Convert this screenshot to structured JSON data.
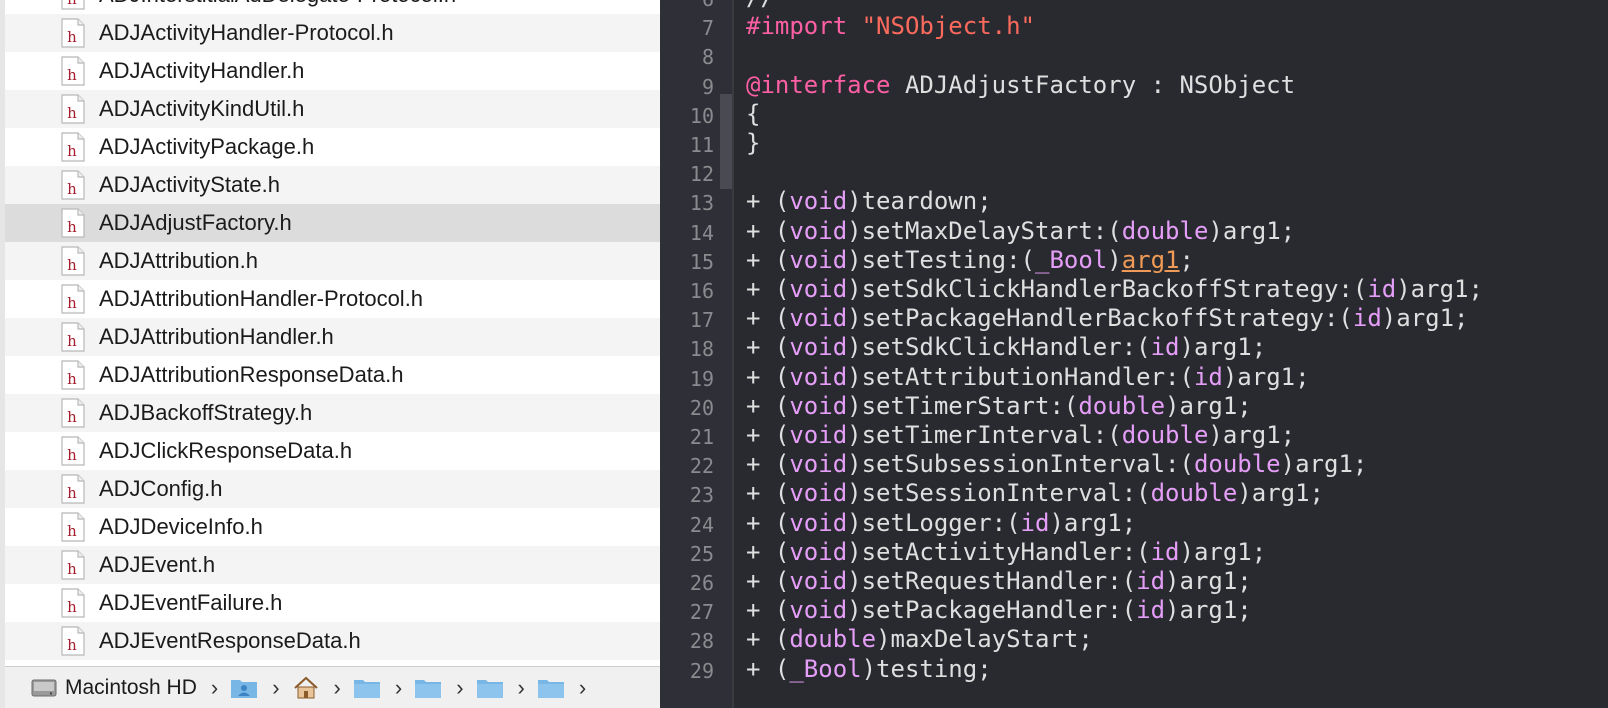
{
  "files": [
    {
      "name": "ADJInterstitialAdDelegate-Protocol.h"
    },
    {
      "name": "ADJActivityHandler-Protocol.h"
    },
    {
      "name": "ADJActivityHandler.h"
    },
    {
      "name": "ADJActivityKindUtil.h"
    },
    {
      "name": "ADJActivityPackage.h"
    },
    {
      "name": "ADJActivityState.h"
    },
    {
      "name": "ADJAdjustFactory.h",
      "selected": true
    },
    {
      "name": "ADJAttribution.h"
    },
    {
      "name": "ADJAttributionHandler-Protocol.h"
    },
    {
      "name": "ADJAttributionHandler.h"
    },
    {
      "name": "ADJAttributionResponseData.h"
    },
    {
      "name": "ADJBackoffStrategy.h"
    },
    {
      "name": "ADJClickResponseData.h"
    },
    {
      "name": "ADJConfig.h"
    },
    {
      "name": "ADJDeviceInfo.h"
    },
    {
      "name": "ADJEvent.h"
    },
    {
      "name": "ADJEventFailure.h"
    },
    {
      "name": "ADJEventResponseData.h"
    }
  ],
  "file_icon_letter": "h",
  "path_bar": {
    "root": "Macintosh HD",
    "separator": "›",
    "folders": [
      "user-folder-icon",
      "home-icon",
      "folder-icon",
      "folder-icon",
      "folder-icon",
      "folder-icon"
    ]
  },
  "colors": {
    "keyword": "#fc5fa3",
    "type": "#e59ef7",
    "string": "#fc6a5d",
    "text": "#dfdfe0",
    "editor_bg": "#292a30"
  },
  "code": [
    {
      "n": "6",
      "tokens": [
        {
          "t": "//",
          "c": "cls"
        }
      ]
    },
    {
      "n": "7",
      "tokens": [
        {
          "t": "#import ",
          "c": "kw"
        },
        {
          "t": "\"NSObject.h\"",
          "c": "str"
        }
      ]
    },
    {
      "n": "8",
      "tokens": []
    },
    {
      "n": "9",
      "tokens": [
        {
          "t": "@interface",
          "c": "kw"
        },
        {
          "t": " ADJAdjustFactory : NSObject",
          "c": "cls"
        }
      ]
    },
    {
      "n": "10",
      "tokens": [
        {
          "t": "{",
          "c": "cls"
        }
      ]
    },
    {
      "n": "11",
      "tokens": [
        {
          "t": "}",
          "c": "cls"
        }
      ]
    },
    {
      "n": "12",
      "tokens": []
    },
    {
      "n": "13",
      "tokens": [
        {
          "t": "+ (",
          "c": "cls"
        },
        {
          "t": "void",
          "c": "ty"
        },
        {
          "t": ")teardown;",
          "c": "cls"
        }
      ]
    },
    {
      "n": "14",
      "tokens": [
        {
          "t": "+ (",
          "c": "cls"
        },
        {
          "t": "void",
          "c": "ty"
        },
        {
          "t": ")setMaxDelayStart:(",
          "c": "cls"
        },
        {
          "t": "double",
          "c": "ty"
        },
        {
          "t": ")arg1;",
          "c": "cls"
        }
      ]
    },
    {
      "n": "15",
      "tokens": [
        {
          "t": "+ (",
          "c": "cls"
        },
        {
          "t": "void",
          "c": "ty"
        },
        {
          "t": ")setTesting:(",
          "c": "cls"
        },
        {
          "t": "_Bool",
          "c": "ty"
        },
        {
          "t": ")",
          "c": "cls"
        },
        {
          "t": "arg1",
          "c": "warn"
        },
        {
          "t": ";",
          "c": "cls"
        }
      ]
    },
    {
      "n": "16",
      "tokens": [
        {
          "t": "+ (",
          "c": "cls"
        },
        {
          "t": "void",
          "c": "ty"
        },
        {
          "t": ")setSdkClickHandlerBackoffStrategy:(",
          "c": "cls"
        },
        {
          "t": "id",
          "c": "ty"
        },
        {
          "t": ")arg1;",
          "c": "cls"
        }
      ]
    },
    {
      "n": "17",
      "tokens": [
        {
          "t": "+ (",
          "c": "cls"
        },
        {
          "t": "void",
          "c": "ty"
        },
        {
          "t": ")setPackageHandlerBackoffStrategy:(",
          "c": "cls"
        },
        {
          "t": "id",
          "c": "ty"
        },
        {
          "t": ")arg1;",
          "c": "cls"
        }
      ]
    },
    {
      "n": "18",
      "tokens": [
        {
          "t": "+ (",
          "c": "cls"
        },
        {
          "t": "void",
          "c": "ty"
        },
        {
          "t": ")setSdkClickHandler:(",
          "c": "cls"
        },
        {
          "t": "id",
          "c": "ty"
        },
        {
          "t": ")arg1;",
          "c": "cls"
        }
      ]
    },
    {
      "n": "19",
      "tokens": [
        {
          "t": "+ (",
          "c": "cls"
        },
        {
          "t": "void",
          "c": "ty"
        },
        {
          "t": ")setAttributionHandler:(",
          "c": "cls"
        },
        {
          "t": "id",
          "c": "ty"
        },
        {
          "t": ")arg1;",
          "c": "cls"
        }
      ]
    },
    {
      "n": "20",
      "tokens": [
        {
          "t": "+ (",
          "c": "cls"
        },
        {
          "t": "void",
          "c": "ty"
        },
        {
          "t": ")setTimerStart:(",
          "c": "cls"
        },
        {
          "t": "double",
          "c": "ty"
        },
        {
          "t": ")arg1;",
          "c": "cls"
        }
      ]
    },
    {
      "n": "21",
      "tokens": [
        {
          "t": "+ (",
          "c": "cls"
        },
        {
          "t": "void",
          "c": "ty"
        },
        {
          "t": ")setTimerInterval:(",
          "c": "cls"
        },
        {
          "t": "double",
          "c": "ty"
        },
        {
          "t": ")arg1;",
          "c": "cls"
        }
      ]
    },
    {
      "n": "22",
      "tokens": [
        {
          "t": "+ (",
          "c": "cls"
        },
        {
          "t": "void",
          "c": "ty"
        },
        {
          "t": ")setSubsessionInterval:(",
          "c": "cls"
        },
        {
          "t": "double",
          "c": "ty"
        },
        {
          "t": ")arg1;",
          "c": "cls"
        }
      ]
    },
    {
      "n": "23",
      "tokens": [
        {
          "t": "+ (",
          "c": "cls"
        },
        {
          "t": "void",
          "c": "ty"
        },
        {
          "t": ")setSessionInterval:(",
          "c": "cls"
        },
        {
          "t": "double",
          "c": "ty"
        },
        {
          "t": ")arg1;",
          "c": "cls"
        }
      ]
    },
    {
      "n": "24",
      "tokens": [
        {
          "t": "+ (",
          "c": "cls"
        },
        {
          "t": "void",
          "c": "ty"
        },
        {
          "t": ")setLogger:(",
          "c": "cls"
        },
        {
          "t": "id",
          "c": "ty"
        },
        {
          "t": ")arg1;",
          "c": "cls"
        }
      ]
    },
    {
      "n": "25",
      "tokens": [
        {
          "t": "+ (",
          "c": "cls"
        },
        {
          "t": "void",
          "c": "ty"
        },
        {
          "t": ")setActivityHandler:(",
          "c": "cls"
        },
        {
          "t": "id",
          "c": "ty"
        },
        {
          "t": ")arg1;",
          "c": "cls"
        }
      ]
    },
    {
      "n": "26",
      "tokens": [
        {
          "t": "+ (",
          "c": "cls"
        },
        {
          "t": "void",
          "c": "ty"
        },
        {
          "t": ")setRequestHandler:(",
          "c": "cls"
        },
        {
          "t": "id",
          "c": "ty"
        },
        {
          "t": ")arg1;",
          "c": "cls"
        }
      ]
    },
    {
      "n": "27",
      "tokens": [
        {
          "t": "+ (",
          "c": "cls"
        },
        {
          "t": "void",
          "c": "ty"
        },
        {
          "t": ")setPackageHandler:(",
          "c": "cls"
        },
        {
          "t": "id",
          "c": "ty"
        },
        {
          "t": ")arg1;",
          "c": "cls"
        }
      ]
    },
    {
      "n": "28",
      "tokens": [
        {
          "t": "+ (",
          "c": "cls"
        },
        {
          "t": "double",
          "c": "ty"
        },
        {
          "t": ")maxDelayStart;",
          "c": "cls"
        }
      ]
    },
    {
      "n": "29",
      "tokens": [
        {
          "t": "+ (",
          "c": "cls"
        },
        {
          "t": "_Bool",
          "c": "ty"
        },
        {
          "t": ")testing;",
          "c": "cls"
        }
      ]
    }
  ]
}
